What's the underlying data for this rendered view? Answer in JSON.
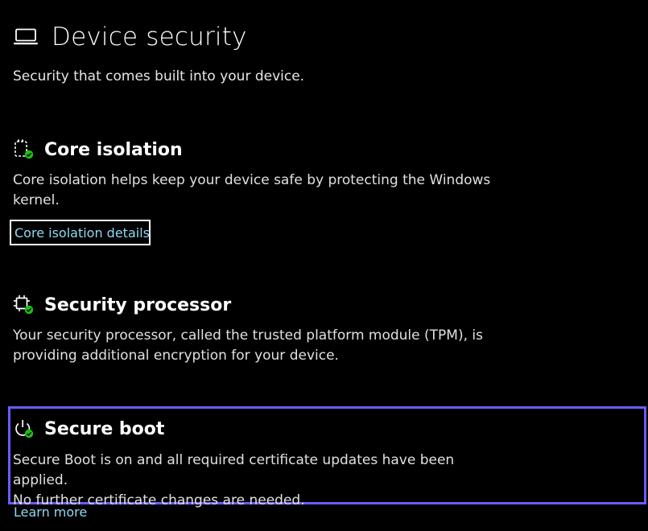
{
  "header": {
    "icon": "laptop-icon",
    "title": "Device security",
    "subtitle": "Security that comes built into your device."
  },
  "sections": {
    "core_isolation": {
      "icon": "core-isolation-icon",
      "title": "Core isolation",
      "description": "Core isolation helps keep your device safe by protecting the Windows kernel.",
      "link": "Core isolation details"
    },
    "security_processor": {
      "icon": "chip-icon",
      "title": "Security processor",
      "description": "Your security processor, called the trusted platform module (TPM), is providing additional encryption for your device."
    },
    "secure_boot": {
      "icon": "power-icon",
      "title": "Secure boot",
      "description_line1": "Secure Boot is on and all required certificate updates have been applied.",
      "description_line2": "No further certificate changes are needed.",
      "link": "Learn more"
    }
  },
  "colors": {
    "background": "#000000",
    "link": "#8fd8f2",
    "status_ok": "#16c60c",
    "focus_highlight": "#6a5cff"
  }
}
